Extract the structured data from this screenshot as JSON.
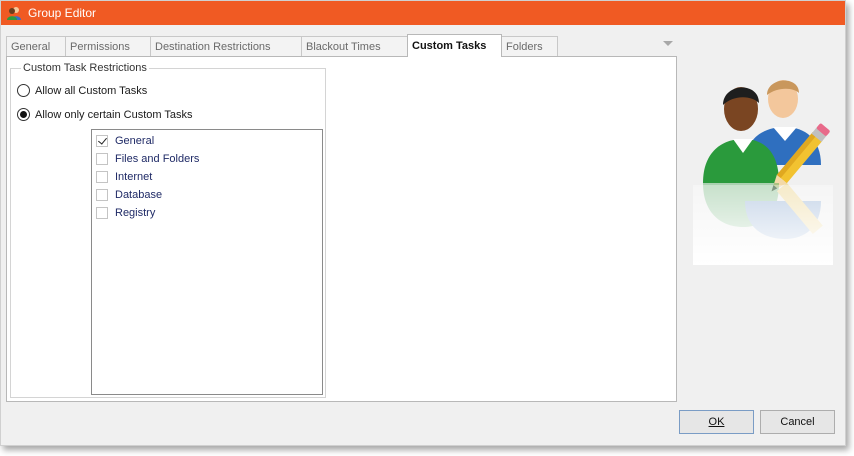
{
  "window": {
    "title": "Group Editor",
    "title_bar_color": "#f05a23",
    "app_icon": "group-users-icon"
  },
  "tabs": [
    {
      "label": "General",
      "active": false
    },
    {
      "label": "Permissions",
      "active": false
    },
    {
      "label": "Destination Restrictions",
      "active": false
    },
    {
      "label": "Blackout Times",
      "active": false
    },
    {
      "label": "Custom Tasks",
      "active": true
    },
    {
      "label": "Folders",
      "active": false
    }
  ],
  "custom_tasks": {
    "group_title": "Custom Task Restrictions",
    "options": [
      {
        "label": "Allow all Custom Tasks",
        "selected": false
      },
      {
        "label": "Allow only certain Custom Tasks",
        "selected": true
      }
    ],
    "tasks": [
      {
        "label": "General",
        "checked": true
      },
      {
        "label": "Files and Folders",
        "checked": false
      },
      {
        "label": "Internet",
        "checked": false
      },
      {
        "label": "Database",
        "checked": false
      },
      {
        "label": "Registry",
        "checked": false
      }
    ]
  },
  "illustration": {
    "icon": "users-edit-icon"
  },
  "buttons": {
    "ok": "OK",
    "cancel": "Cancel"
  }
}
